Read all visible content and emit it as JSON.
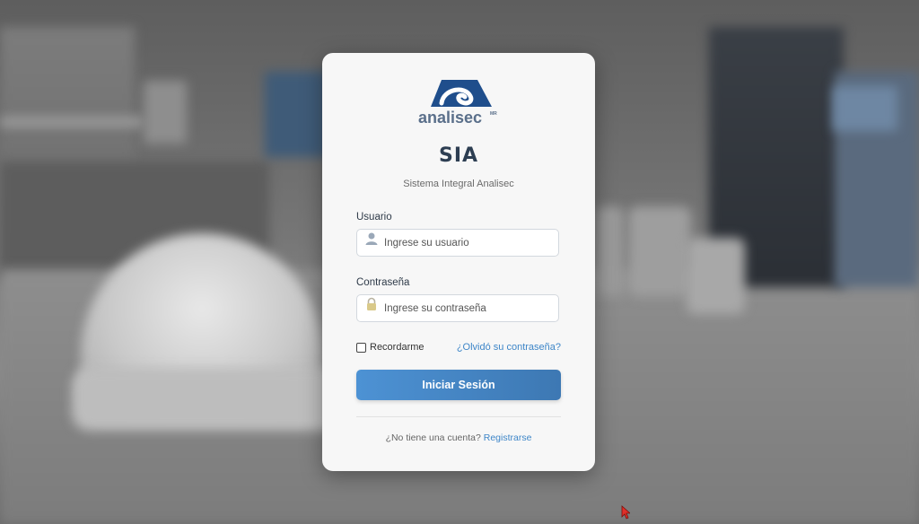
{
  "app": {
    "brand": "analisec",
    "brand_mark": "MR",
    "title": "SIA",
    "subtitle": "Sistema Integral Analisec"
  },
  "form": {
    "username_label": "Usuario",
    "username_placeholder": "Ingrese su usuario",
    "password_label": "Contraseña",
    "password_placeholder": "Ingrese su contraseña",
    "remember_label": "Recordarme",
    "remember_checked": false,
    "forgot_link": "¿Olvidó su contraseña?",
    "submit_label": "Iniciar Sesión"
  },
  "footer": {
    "question": "¿No tiene una cuenta?",
    "register_link": "Registrarse"
  },
  "icons": {
    "user_field": "user-icon",
    "password_field": "lock-icon",
    "cursor": "mouse-cursor-icon"
  },
  "colors": {
    "accent": "#4a8ed0",
    "brand_blue": "#1f4e8c",
    "title": "#2d3e52",
    "link": "#3e86c8"
  }
}
